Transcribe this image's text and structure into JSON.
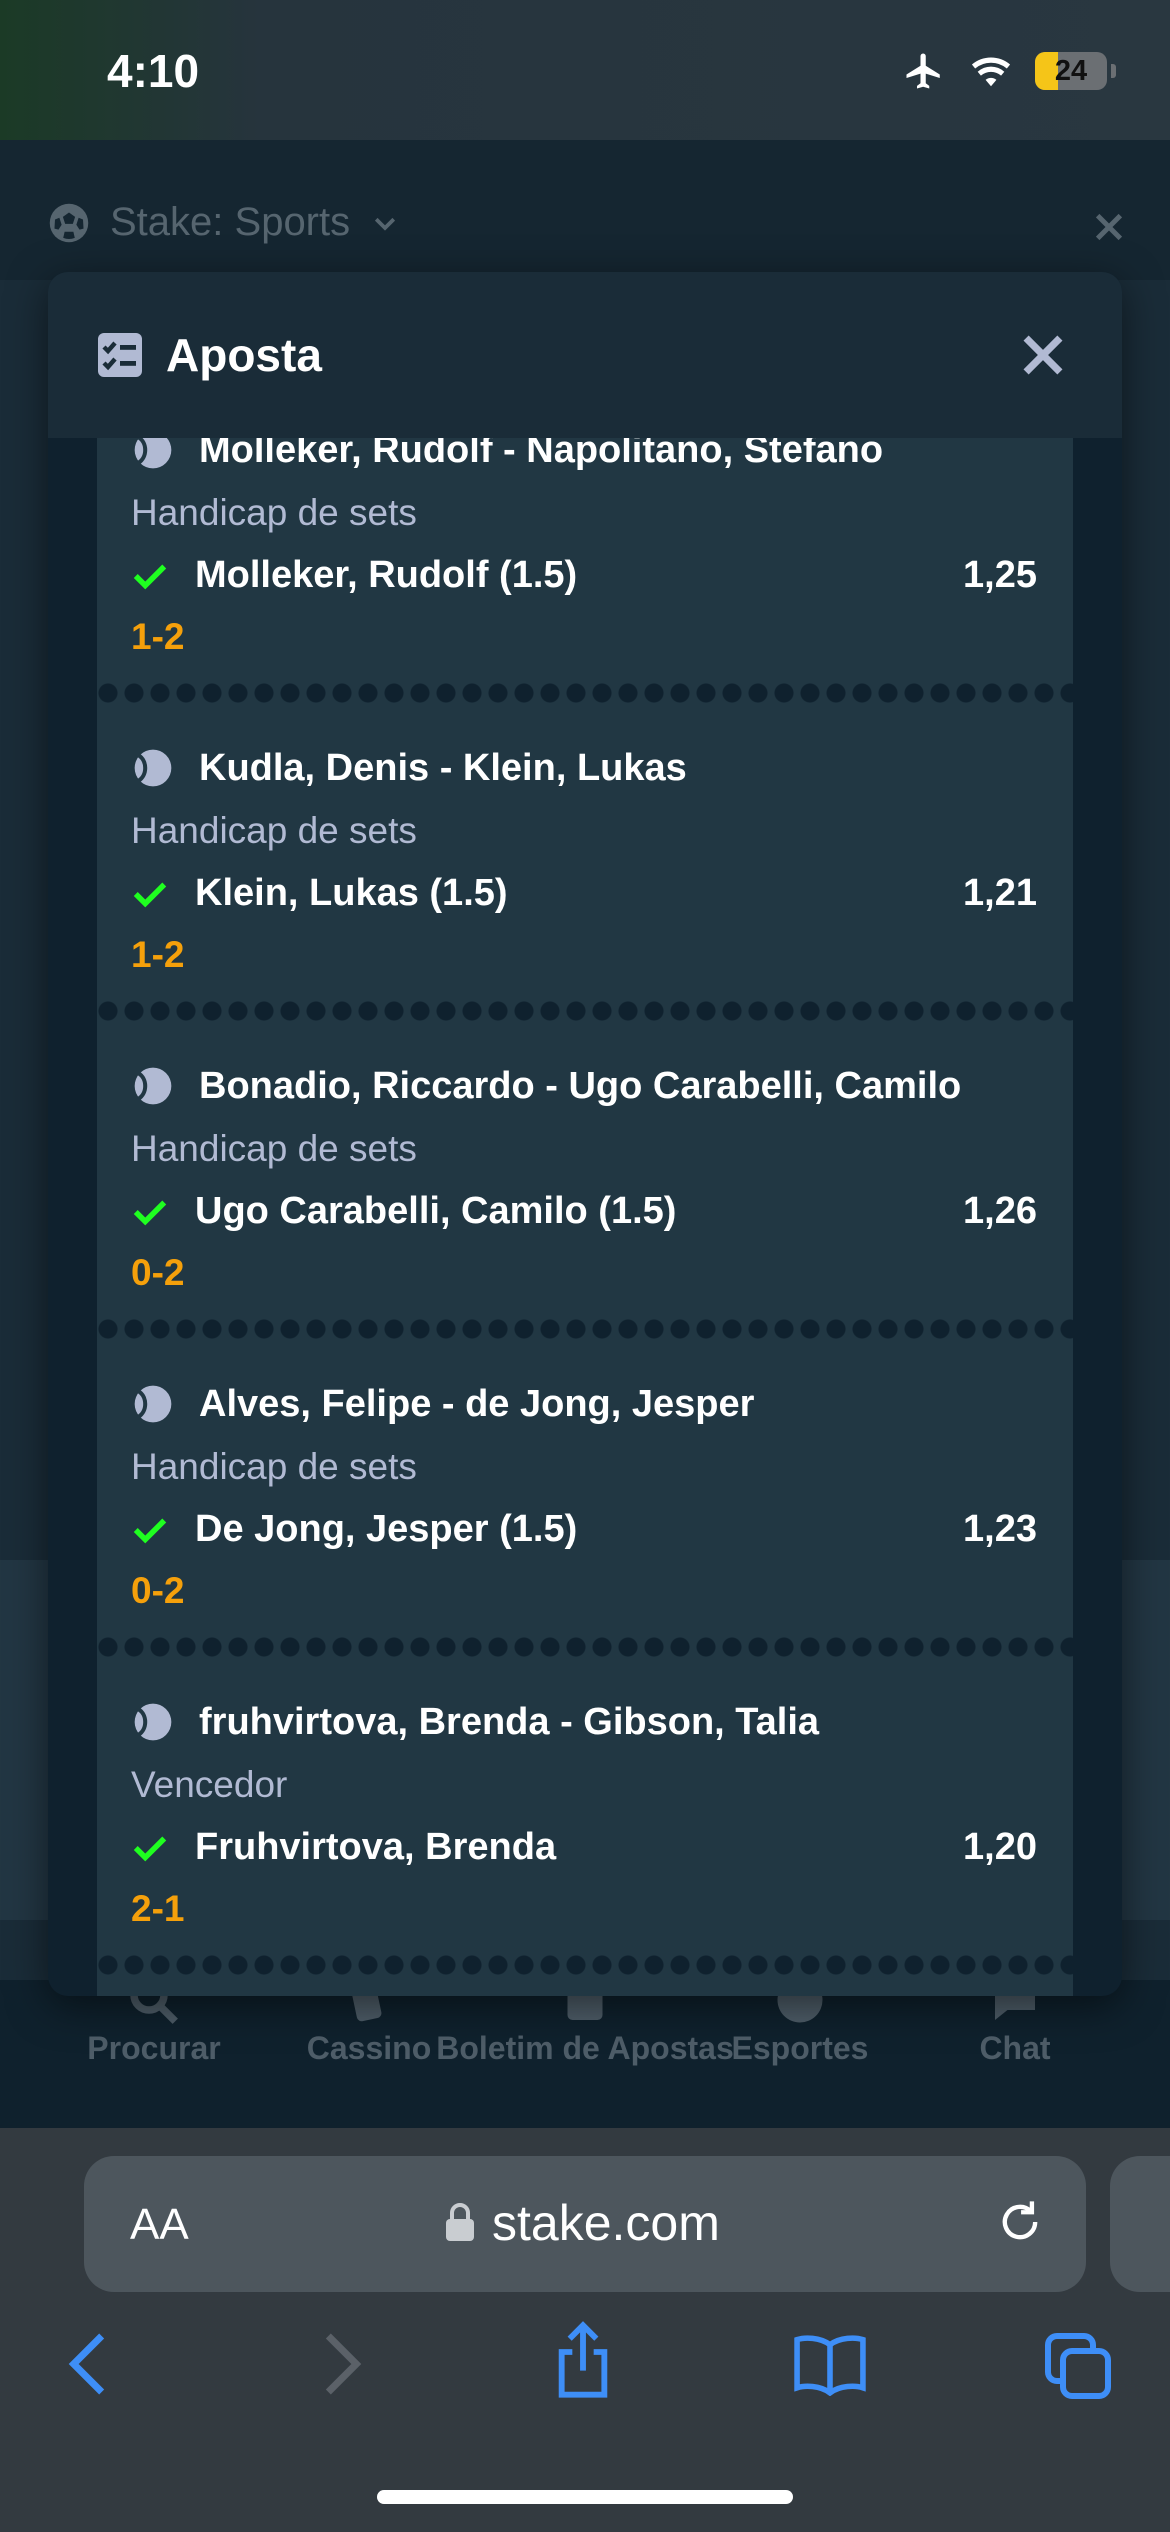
{
  "status_bar": {
    "time": "4:10",
    "battery": "24"
  },
  "app_header": {
    "title": "Stake: Sports"
  },
  "modal": {
    "title": "Aposta"
  },
  "bets": [
    {
      "match": "Molleker, Rudolf - Napolitano, Stefano",
      "market": "Handicap de sets",
      "selection": "Molleker, Rudolf (1.5)",
      "odds": "1,25",
      "score": "1-2"
    },
    {
      "match": "Kudla, Denis - Klein, Lukas",
      "market": "Handicap de sets",
      "selection": "Klein, Lukas (1.5)",
      "odds": "1,21",
      "score": "1-2"
    },
    {
      "match": "Bonadio, Riccardo - Ugo Carabelli, Camilo",
      "market": "Handicap de sets",
      "selection": "Ugo Carabelli, Camilo (1.5)",
      "odds": "1,26",
      "score": "0-2"
    },
    {
      "match": "Alves, Felipe - de Jong, Jesper",
      "market": "Handicap de sets",
      "selection": "De Jong, Jesper (1.5)",
      "odds": "1,23",
      "score": "0-2"
    },
    {
      "match": "fruhvirtova, Brenda - Gibson, Talia",
      "market": "Vencedor",
      "selection": "Fruhvirtova, Brenda",
      "odds": "1,20",
      "score": "2-1"
    }
  ],
  "site_nav": {
    "search": "Procurar",
    "casino": "Cassino",
    "betslip": "Boletim de Apostas",
    "sports": "Esportes",
    "chat": "Chat"
  },
  "browser": {
    "aa_label": "AA",
    "url": "stake.com"
  },
  "colors": {
    "accent_green": "#1fff20",
    "score_orange": "#f5a00b",
    "safari_blue": "#3e8ef7"
  }
}
